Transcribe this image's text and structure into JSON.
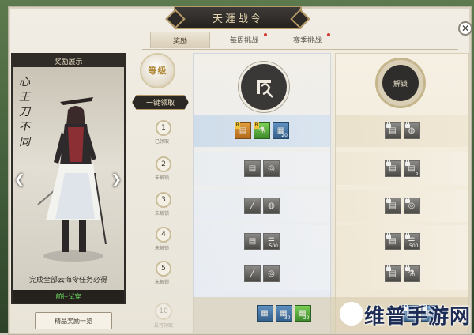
{
  "window": {
    "title": "天涯战令",
    "close_glyph": "✕"
  },
  "tabs": [
    {
      "label": "奖励",
      "active": true,
      "dot": false
    },
    {
      "label": "每周挑战",
      "active": false,
      "dot": true
    },
    {
      "label": "赛季挑战",
      "active": false,
      "dot": true
    }
  ],
  "showcase": {
    "header": "奖励展示",
    "calligraphy": "心王刀不同",
    "prev_glyph": "❮",
    "next_glyph": "❯",
    "description": "完成全部云海令任务必得",
    "try_on": "前往试穿"
  },
  "level": {
    "emblem_text": "等级",
    "claim_all": "一键领取",
    "levels": [
      {
        "num": "1",
        "status": "已领取"
      },
      {
        "num": "2",
        "status": "未解锁"
      },
      {
        "num": "3",
        "status": "未解锁"
      },
      {
        "num": "4",
        "status": "未解锁"
      },
      {
        "num": "5",
        "status": "未解锁"
      }
    ],
    "next": {
      "num": "10",
      "status": "最可领取"
    }
  },
  "free_track": {
    "emblem_icon": "wind-seal-icon",
    "rows": [
      [
        {
          "icon": "ticket-icon",
          "style": "orange",
          "badge": "B"
        },
        {
          "icon": "potion-icon",
          "style": "orange",
          "badge": "B"
        },
        {
          "icon": "scroll-icon",
          "style": "blue",
          "count": "20"
        }
      ],
      [
        {
          "icon": "scroll-icon",
          "style": "gray"
        },
        {
          "icon": "coin-icon",
          "style": "gray"
        }
      ],
      [
        {
          "icon": "brush-icon",
          "style": "gray"
        },
        {
          "icon": "bag-icon",
          "style": "gray"
        }
      ],
      [
        {
          "icon": "scroll-icon",
          "style": "gray"
        },
        {
          "icon": "stack-icon",
          "style": "gray",
          "count": "500"
        }
      ],
      [
        {
          "icon": "brush-icon",
          "style": "gray"
        },
        {
          "icon": "coin-icon",
          "style": "gray"
        }
      ],
      [
        {
          "icon": "scroll-icon",
          "style": "blue"
        },
        {
          "icon": "scroll-icon",
          "style": "blue",
          "count": "30"
        },
        {
          "icon": "scroll-icon",
          "style": "green",
          "count": "20"
        }
      ]
    ]
  },
  "premium_track": {
    "emblem_label": "解锁",
    "rows": [
      [
        {
          "icon": "scroll-icon",
          "style": "gray",
          "locked": true
        },
        {
          "icon": "bag-icon",
          "style": "gray",
          "locked": true
        }
      ],
      [
        {
          "icon": "scroll-icon",
          "style": "gray",
          "locked": true
        },
        {
          "icon": "scroll-icon",
          "style": "gray",
          "locked": true,
          "count": "5"
        }
      ],
      [
        {
          "icon": "scroll-icon",
          "style": "gray",
          "locked": true
        },
        {
          "icon": "coin-icon",
          "style": "gray",
          "locked": true
        }
      ],
      [
        {
          "icon": "scroll-icon",
          "style": "gray",
          "locked": true
        },
        {
          "icon": "stack-icon",
          "style": "gray",
          "locked": true,
          "count": "500"
        }
      ],
      [
        {
          "icon": "scroll-icon",
          "style": "gray",
          "locked": true
        },
        {
          "icon": "potion-icon",
          "style": "gray",
          "locked": true
        }
      ],
      [
        {
          "icon": "scroll-icon",
          "style": "blue",
          "locked": true
        },
        {
          "icon": "scroll-icon",
          "style": "blue",
          "locked": true
        }
      ]
    ]
  },
  "bottom": {
    "elite_rewards": "精品奖励一览"
  },
  "watermark": "维普手游网",
  "colors": {
    "accent_gold": "#b49a67",
    "dark": "#2c2925",
    "try_on_green": "#6ddc61",
    "notify_red": "#d23a2f"
  }
}
